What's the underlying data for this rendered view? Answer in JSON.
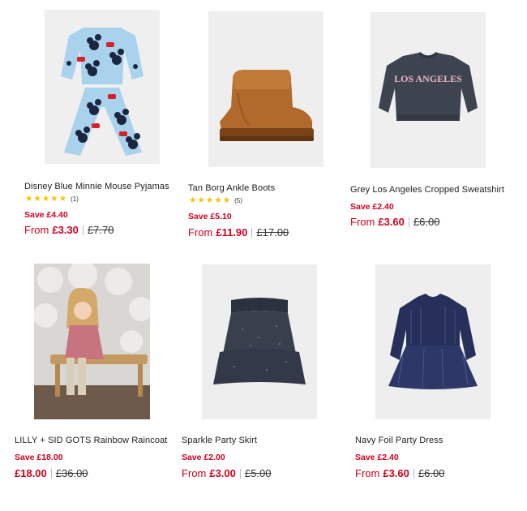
{
  "products": [
    {
      "title": "Disney Blue Minnie Mouse Pyjamas",
      "image": "pyjamas-image",
      "rating": {
        "stars": 5,
        "count": "(1)"
      },
      "save": "Save £4.40",
      "from": "From",
      "price": "£3.30",
      "was": "£7.70"
    },
    {
      "title": "Tan Borg Ankle Boots",
      "image": "boots-image",
      "rating": {
        "stars": 5,
        "count": "(5)"
      },
      "save": "Save £5.10",
      "from": "From",
      "price": "£11.90",
      "was": "£17.00"
    },
    {
      "title": "Grey Los Angeles Cropped Sweatshirt",
      "image": "sweatshirt-image",
      "sweatshirt_print": "LOS ANGELES",
      "save": "Save £2.40",
      "from": "From",
      "price": "£3.60",
      "was": "£6.00"
    },
    {
      "title": "LILLY + SID GOTS Rainbow Raincoat",
      "image": "raincoat-image",
      "save": "Save £18.00",
      "price": "£18.00",
      "was": "£36.00"
    },
    {
      "title": "Sparkle Party Skirt",
      "image": "skirt-image",
      "save": "Save £2.00",
      "from": "From",
      "price": "£3.00",
      "was": "£5.00"
    },
    {
      "title": "Navy Foil Party Dress",
      "image": "dress-image",
      "save": "Save £2.40",
      "from": "From",
      "price": "£3.60",
      "was": "£6.00"
    }
  ],
  "colors": {
    "sale_red": "#d4001f",
    "star_yellow": "#f5c400"
  },
  "icons": {
    "star": "star-icon"
  }
}
